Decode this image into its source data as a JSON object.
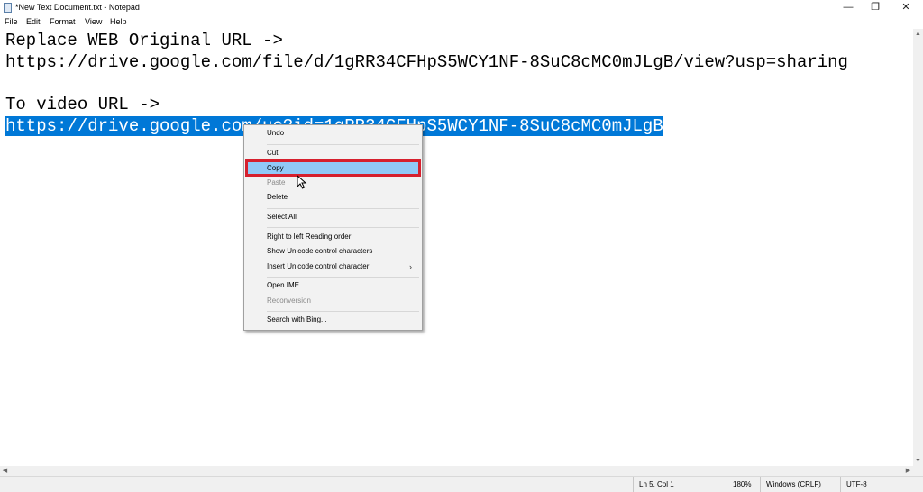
{
  "window": {
    "title": "*New Text Document.txt - Notepad",
    "minimize_glyph": "—",
    "restore_glyph": "❐",
    "close_glyph": "✕"
  },
  "menu": [
    "File",
    "Edit",
    "Format",
    "View",
    "Help"
  ],
  "editor": {
    "lines": [
      "Replace WEB Original URL ->",
      "https://drive.google.com/file/d/1gRR34CFHpS5WCY1NF-8SuC8cMC0mJLgB/view?usp=sharing",
      "",
      "To video URL ->",
      "https://drive.google.com/uc?id=1gRR34CFHpS5WCY1NF-8SuC8cMC0mJLgB"
    ],
    "selected_line": 5
  },
  "context_menu": {
    "items": [
      {
        "label": "Undo",
        "enabled": true
      },
      {
        "label": "Cut",
        "enabled": true
      },
      {
        "label": "Copy",
        "enabled": true,
        "hovered": true,
        "highlighted": true
      },
      {
        "label": "Paste",
        "enabled": false
      },
      {
        "label": "Delete",
        "enabled": true
      },
      {
        "label": "Select All",
        "enabled": true
      },
      {
        "label": "Right to left Reading order",
        "enabled": true
      },
      {
        "label": "Show Unicode control characters",
        "enabled": true
      },
      {
        "label": "Insert Unicode control character",
        "enabled": true,
        "submenu": true
      },
      {
        "label": "Open IME",
        "enabled": true
      },
      {
        "label": "Reconversion",
        "enabled": false
      },
      {
        "label": "Search with Bing...",
        "enabled": true
      }
    ],
    "submenu_glyph": "›"
  },
  "statusbar": {
    "position": "Ln 5, Col 1",
    "zoom": "180%",
    "line_ending": "Windows (CRLF)",
    "encoding": "UTF-8"
  },
  "colors": {
    "selection": "#0078d7",
    "menu_hover": "#91c9f7",
    "highlight_border": "#d6202e"
  },
  "icons": {
    "app": "notepad-icon",
    "cursor": "mouse-pointer-icon"
  }
}
